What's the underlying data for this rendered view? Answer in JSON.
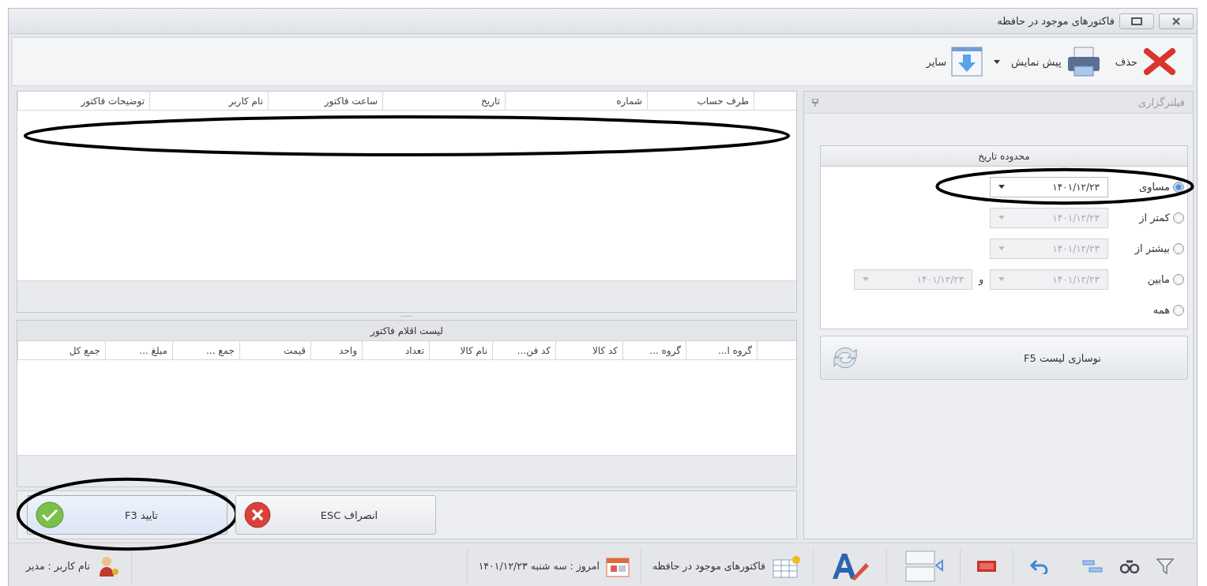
{
  "window": {
    "title": "فاکتورهای موجود در حافظه"
  },
  "toolbar": {
    "delete": "حذف",
    "preview": "پیش نمایش",
    "more": "سایر"
  },
  "filter_panel": {
    "title": "فیلترگزاری",
    "group_title": "محدوده تاریخ",
    "options": [
      {
        "label": "مساوی",
        "selected": true,
        "fields": [
          {
            "value": "۱۴۰۱/۱۲/۲۳",
            "disabled": false
          }
        ]
      },
      {
        "label": "کمتر از",
        "selected": false,
        "fields": [
          {
            "value": "۱۴۰۱/۱۲/۲۳",
            "disabled": true
          }
        ]
      },
      {
        "label": "بیشتر از",
        "selected": false,
        "fields": [
          {
            "value": "۱۴۰۱/۱۲/۲۳",
            "disabled": true
          }
        ]
      },
      {
        "label": "مابین",
        "selected": false,
        "joiner": "و",
        "fields": [
          {
            "value": "۱۴۰۱/۱۲/۲۳",
            "disabled": true
          },
          {
            "value": "۱۴۰۱/۱۲/۲۳",
            "disabled": true
          }
        ]
      },
      {
        "label": "همه",
        "selected": false
      }
    ],
    "refresh_button": "نوسازی لیست  F5"
  },
  "invoice_table": {
    "columns": [
      "طرف حساب",
      "شماره",
      "تاریخ",
      "ساعت فاکتور",
      "نام کاربر",
      "توضیحات فاکتور"
    ]
  },
  "items_table": {
    "title": "لیست اقلام فاکتور",
    "columns": [
      "گروه ا...",
      "گروه ...",
      "کد کالا",
      "کد فن...",
      "نام کالا",
      "تعداد",
      "واحد",
      "قیمت",
      "جمع ...",
      "مبلغ ...",
      "جمع کل"
    ]
  },
  "buttons": {
    "confirm": "تایید  F3",
    "cancel": "انصراف  ESC"
  },
  "status_bar": {
    "user": "نام کاربر : مدیر",
    "today": "امروز : سه شنبه  ۱۴۰۱/۱۲/۲۳",
    "form": "فاکتورهای موجود در حافظه"
  }
}
